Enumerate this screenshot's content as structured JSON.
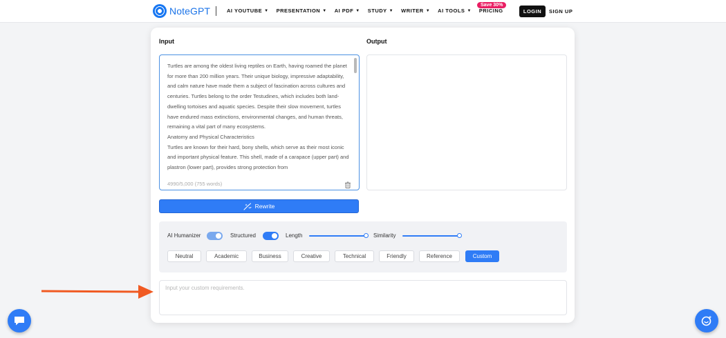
{
  "header": {
    "brand": "NoteGPT",
    "nav": [
      {
        "label": "AI YOUTUBE",
        "has_dropdown": true
      },
      {
        "label": "PRESENTATION",
        "has_dropdown": true
      },
      {
        "label": "AI PDF",
        "has_dropdown": true
      },
      {
        "label": "STUDY",
        "has_dropdown": true
      },
      {
        "label": "WRITER",
        "has_dropdown": true
      },
      {
        "label": "AI TOOLS",
        "has_dropdown": true
      },
      {
        "label": "PRICING",
        "has_dropdown": false
      }
    ],
    "promo_badge": "Save 30%",
    "login_label": "LOGIN",
    "signup_label": "SIGN UP"
  },
  "input_section": {
    "title": "Input",
    "paragraphs": [
      "Turtles are among the oldest living reptiles on Earth, having roamed the planet for more than 200 million years. Their unique biology, impressive adaptability, and calm nature have made them a subject of fascination across cultures and centuries. Turtles belong to the order Testudines, which includes both land-dwelling tortoises and aquatic species. Despite their slow movement, turtles have endured mass extinctions, environmental changes, and human threats, remaining a vital part of many ecosystems.",
      "Anatomy and Physical Characteristics",
      "Turtles are known for their hard, bony shells, which serve as their most iconic and important physical feature. This shell, made of a carapace (upper part) and plastron (lower part), provides strong protection from"
    ],
    "counter": "4990/5,000 (755 words)"
  },
  "output_section": {
    "title": "Output",
    "text": ""
  },
  "rewrite_button": {
    "label": "Rewrite",
    "icon": "wand-icon"
  },
  "options": {
    "ai_humanizer": {
      "label": "AI Humanizer",
      "enabled": true
    },
    "structured": {
      "label": "Structured",
      "enabled": true
    },
    "length": {
      "label": "Length",
      "value": 1.0
    },
    "similarity": {
      "label": "Similarity",
      "value": 1.0
    },
    "styles": [
      "Neutral",
      "Academic",
      "Business",
      "Creative",
      "Technical",
      "Friendly",
      "Reference",
      "Custom"
    ],
    "selected_style": "Custom"
  },
  "custom_requirements": {
    "placeholder": "Input your custom requirements.",
    "value": ""
  },
  "colors": {
    "accent": "#2f7cf6",
    "toggle_humanizer": "#7aa9ee",
    "annotation_arrow": "#f05a22",
    "promo": "#e91e63"
  },
  "floating": {
    "left_button_icon": "chat-bubble-icon",
    "right_button_icon": "assistant-icon"
  }
}
